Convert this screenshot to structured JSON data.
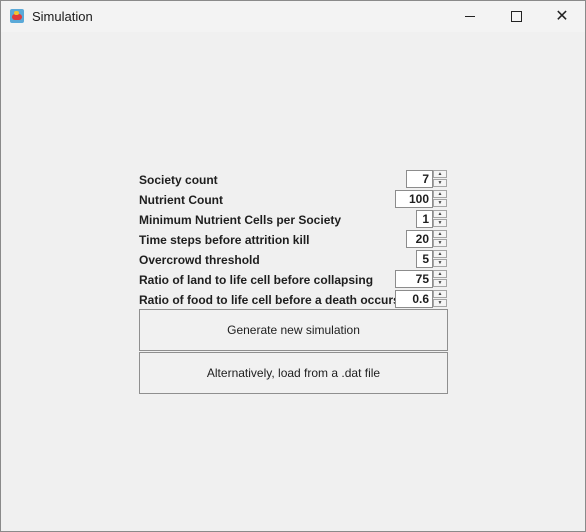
{
  "window": {
    "title": "Simulation"
  },
  "form": {
    "fields": [
      {
        "label": "Society count",
        "value": "7"
      },
      {
        "label": "Nutrient Count",
        "value": "100"
      },
      {
        "label": "Minimum Nutrient Cells per Society",
        "value": "1"
      },
      {
        "label": "Time steps before attrition kill",
        "value": "20"
      },
      {
        "label": "Overcrowd threshold",
        "value": "5"
      },
      {
        "label": "Ratio of land to life cell before collapsing",
        "value": "75"
      },
      {
        "label": "Ratio of food to life cell before a death occurs",
        "value": "0.6"
      }
    ],
    "spinner_arrows": {
      "up": "▲",
      "down": "▼"
    }
  },
  "buttons": {
    "generate": "Generate new simulation",
    "load": "Alternatively, load from a .dat file"
  },
  "icons": {
    "minimize": "minimize-icon",
    "maximize": "maximize-icon",
    "close": "close-icon",
    "app": "app-icon"
  },
  "colors": {
    "window_bg": "#f0f0f0",
    "titlebar_bg": "#f3f3f3",
    "field_bg": "#ffffff",
    "border": "#8c8c8c"
  }
}
